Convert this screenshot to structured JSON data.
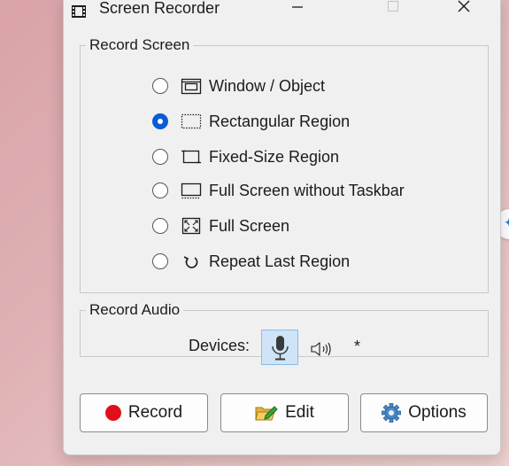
{
  "window": {
    "title": "Screen Recorder"
  },
  "record_screen": {
    "legend": "Record Screen",
    "options": [
      {
        "label": "Window / Object",
        "icon": "window-icon",
        "checked": false
      },
      {
        "label": "Rectangular Region",
        "icon": "dotted-rectangle-icon",
        "checked": true
      },
      {
        "label": "Fixed-Size Region",
        "icon": "fixed-region-icon",
        "checked": false
      },
      {
        "label": "Full Screen without Taskbar",
        "icon": "screen-without-taskbar-icon",
        "checked": false
      },
      {
        "label": "Full Screen",
        "icon": "fullscreen-icon",
        "checked": false
      },
      {
        "label": "Repeat Last Region",
        "icon": "repeat-icon",
        "checked": false
      }
    ]
  },
  "record_audio": {
    "legend": "Record Audio",
    "devices_label": "Devices:",
    "microphone_selected": true,
    "extra": "*"
  },
  "buttons": {
    "record": "Record",
    "edit": "Edit",
    "options": "Options"
  },
  "colors": {
    "accent": "#0a5bd6",
    "record_red": "#e0101a",
    "selected_bg": "#cfe4f7"
  }
}
